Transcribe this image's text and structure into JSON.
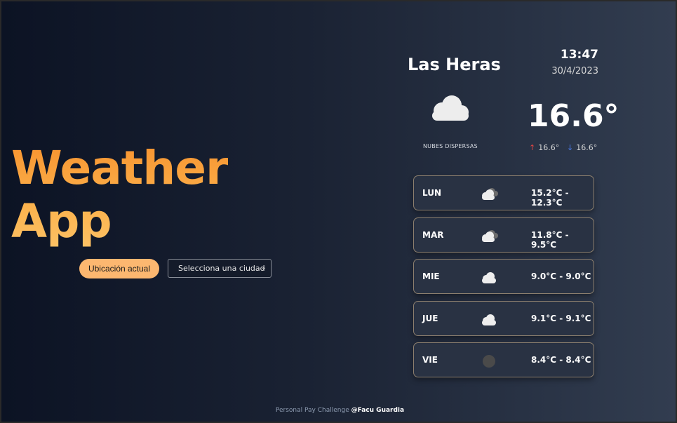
{
  "app": {
    "title_line1": "Weather",
    "title_line2": "App",
    "location_button": "Ubicación actual",
    "city_select": {
      "value": "Selecciona una ciudad"
    }
  },
  "current": {
    "city": "Las Heras",
    "time": "13:47",
    "date": "30/4/2023",
    "temperature": "16.6°",
    "description": "NUBES DISPERSAS",
    "icon": "cloud-icon",
    "max": "16.6°",
    "min": "16.6°"
  },
  "forecast": [
    {
      "day": "LUN",
      "icon": "broken-clouds-icon",
      "range": "15.2°C - 12.3°C"
    },
    {
      "day": "MAR",
      "icon": "broken-clouds-icon",
      "range": "11.8°C - 9.5°C"
    },
    {
      "day": "MIE",
      "icon": "cloud-icon",
      "range": "9.0°C - 9.0°C"
    },
    {
      "day": "JUE",
      "icon": "cloud-icon",
      "range": "9.1°C - 9.1°C"
    },
    {
      "day": "VIE",
      "icon": "clear-night-icon",
      "range": "8.4°C - 8.4°C"
    }
  ],
  "footer": {
    "text": "Personal Pay Challenge",
    "author": "@Facu Guardia"
  },
  "colors": {
    "accent": "#fcb770",
    "title_gradient_start": "#f7932f",
    "title_gradient_end": "#fdc265",
    "card_border": "#8c7f6e",
    "max_arrow": "#e04545",
    "min_arrow": "#4d7ff0"
  }
}
